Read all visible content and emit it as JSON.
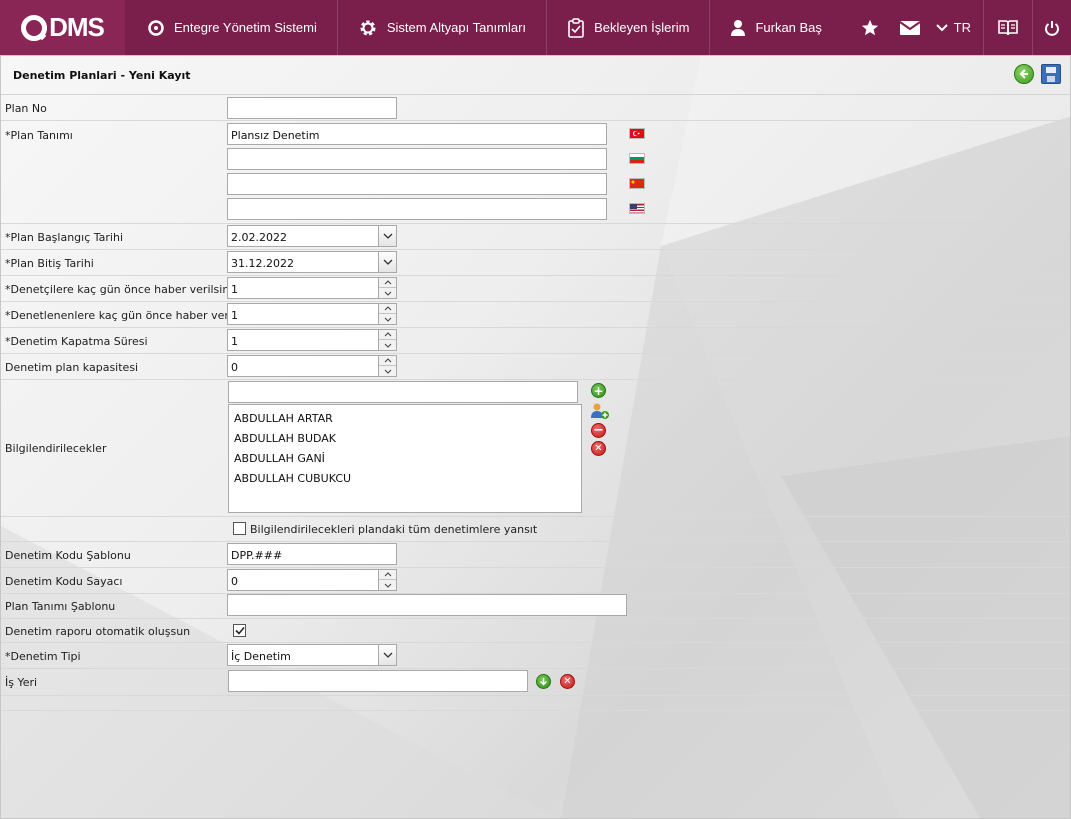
{
  "nav": {
    "logo_text": "DMS",
    "items": [
      {
        "label": "Entegre Yönetim Sistemi",
        "icon": "q-logo-icon"
      },
      {
        "label": "Sistem Altyapı Tanımları",
        "icon": "gear-icon"
      },
      {
        "label": "Bekleyen İşlerim",
        "icon": "clipboard-icon"
      },
      {
        "label": "Furkan Baş",
        "icon": "user-icon"
      }
    ],
    "language": "TR",
    "right_icons": [
      "star-icon",
      "mail-icon",
      "chevron-down-icon",
      "book-icon",
      "power-icon"
    ]
  },
  "page": {
    "title": "Denetim Planlari - Yeni Kayıt"
  },
  "form": {
    "plan_no": {
      "label": "Plan No",
      "value": ""
    },
    "plan_tanimi": {
      "label": "*Plan Tanımı",
      "values": [
        "Plansız Denetim",
        "",
        "",
        ""
      ],
      "flags": [
        "turkey-flag-icon",
        "bulgaria-flag-icon",
        "china-flag-icon",
        "usa-flag-icon"
      ]
    },
    "baslangic": {
      "label": "*Plan Başlangıç Tarihi",
      "value": "2.02.2022"
    },
    "bitis": {
      "label": "*Plan Bitiş Tarihi",
      "value": "31.12.2022"
    },
    "denetci_gun": {
      "label": "*Denetçilere kaç gün önce haber verilsin?",
      "value": "1"
    },
    "denetlenen_gun": {
      "label": "*Denetlenenlere kaç gün önce haber verilsin?",
      "value": "1"
    },
    "kapatma": {
      "label": "*Denetim Kapatma Süresi",
      "value": "1"
    },
    "kapasite": {
      "label": "Denetim plan kapasitesi",
      "value": "0"
    },
    "bilgilendirilecekler": {
      "label": "Bilgilendirilecekler",
      "search_value": "",
      "items": [
        "ABDULLAH ARTAR",
        "ABDULLAH BUDAK",
        "ABDULLAH GANİ",
        "ABDULLAH CUBUKCU"
      ]
    },
    "yansit": {
      "label": "Bilgilendirilecekleri plandaki tüm denetimlere yansıt",
      "checked": false
    },
    "kod_sablonu": {
      "label": "Denetim Kodu Şablonu",
      "value": "DPP.###"
    },
    "kod_sayaci": {
      "label": "Denetim Kodu Sayacı",
      "value": "0"
    },
    "tanim_sablonu": {
      "label": "Plan Tanımı Şablonu",
      "value": ""
    },
    "otomatik": {
      "label": "Denetim raporu otomatik oluşsun",
      "checked": true
    },
    "denetim_tipi": {
      "label": "*Denetim Tipi",
      "value": "İç Denetim"
    },
    "is_yeri": {
      "label": "İş Yeri",
      "value": ""
    }
  }
}
